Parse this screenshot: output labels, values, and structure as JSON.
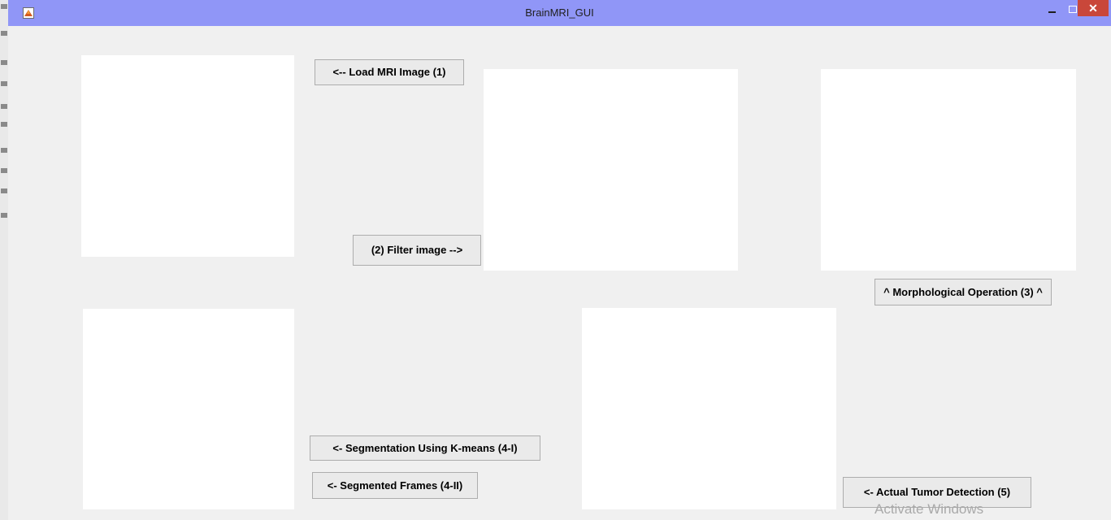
{
  "window": {
    "title": "BrainMRI_GUI",
    "minimize_glyph": "–",
    "close_glyph": "✕"
  },
  "buttons": {
    "load": "<-- Load MRI Image (1)",
    "filter": "(2) Filter image -->",
    "morph": "^ Morphological Operation (3) ^",
    "kmeans": "<- Segmentation Using K-means (4-I)",
    "segmented_frames": "<- Segmented Frames (4-II)",
    "tumor": "<- Actual Tumor Detection (5)"
  },
  "watermark": "Activate Windows",
  "icons": {
    "app": "matlab-icon"
  },
  "colors": {
    "titlebar": "#9096f7",
    "close": "#c9473a",
    "background": "#f0f0f0",
    "axes": "#ffffff"
  }
}
